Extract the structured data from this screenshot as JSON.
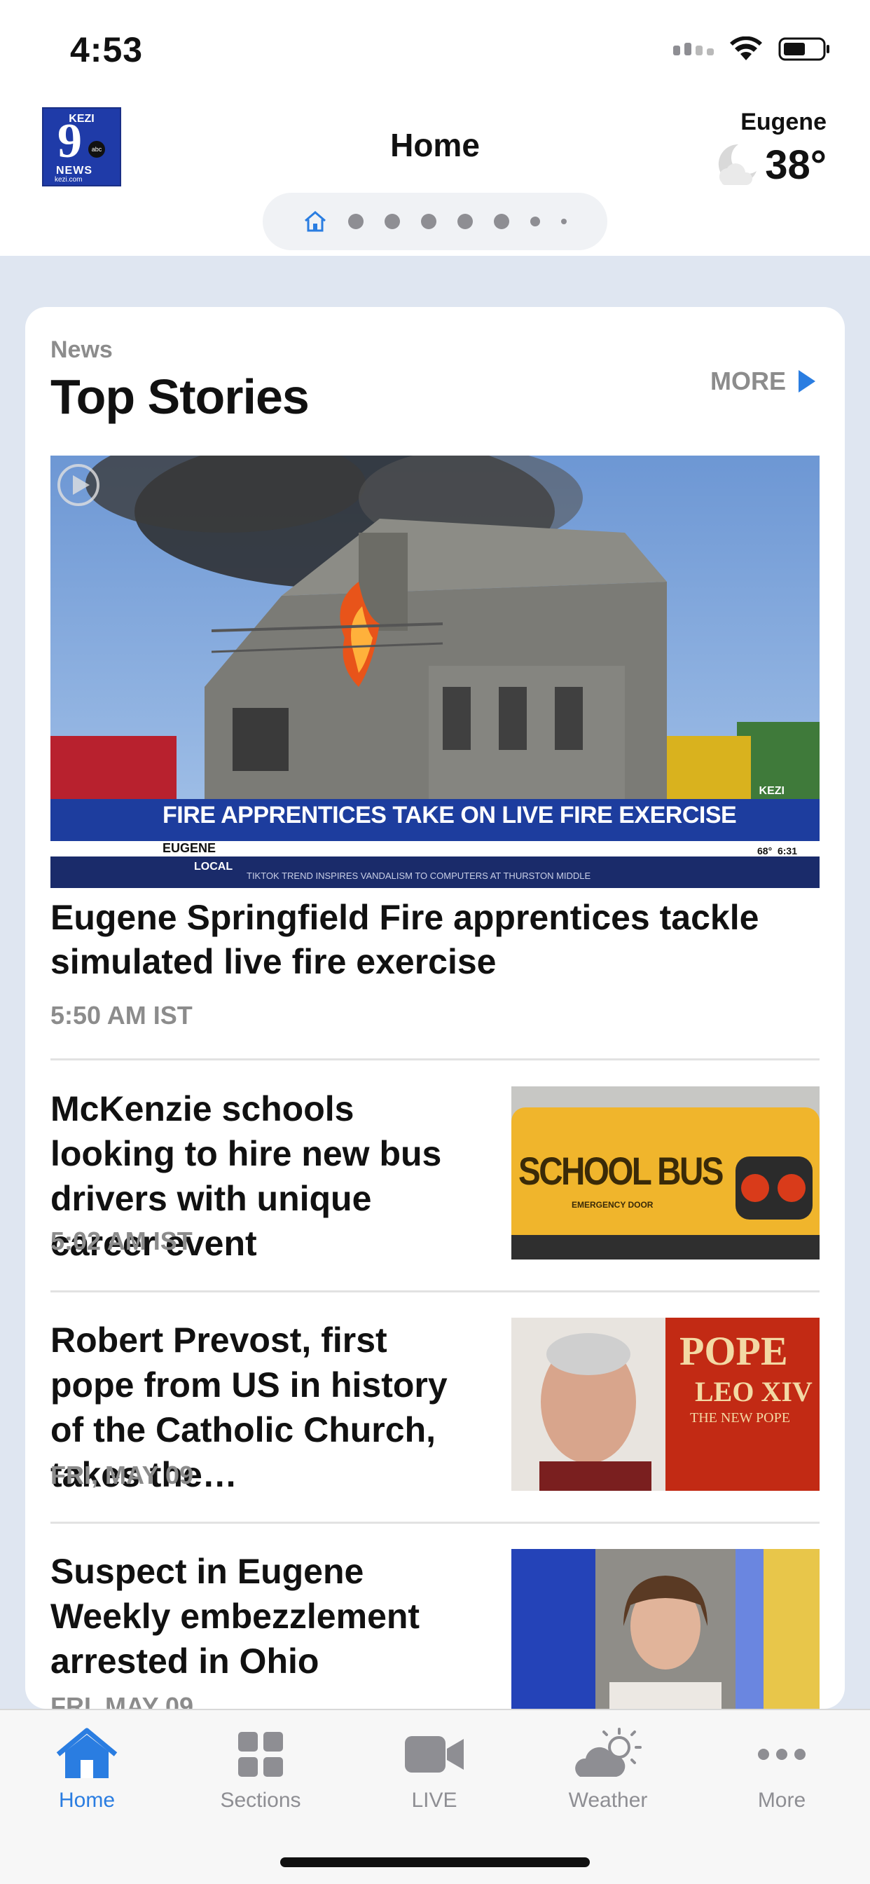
{
  "status_bar": {
    "time": "4:53"
  },
  "header": {
    "logo": {
      "top": "KEZI",
      "nine": "9",
      "news": "NEWS",
      "url": "kezi.com"
    },
    "title": "Home",
    "weather": {
      "city": "Eugene",
      "temp": "38°",
      "icon": "moon-cloud-icon"
    }
  },
  "pager": {
    "active": "home-icon",
    "dots": 7
  },
  "section": {
    "label": "News",
    "title": "Top Stories",
    "more": "MORE"
  },
  "hero": {
    "banner": "FIRE APPRENTICES TAKE ON LIVE FIRE EXERCISE",
    "location": "EUGENE",
    "tag": "LOCAL",
    "ticker": "TIKTOK TREND INSPIRES VANDALISM TO COMPUTERS AT THURSTON MIDDLE",
    "channel": "KEZI",
    "weather_time": "68°  6:31",
    "headline": "Eugene Springfield Fire apprentices tackle simulated live fire exercise",
    "time": "5:50 AM IST"
  },
  "stories": [
    {
      "headline": "McKenzie schools looking to hire new bus drivers with unique career event",
      "time": "5:02 AM IST",
      "thumb_text": "SCHOOL BUS",
      "thumb_sub": "EMERGENCY DOOR"
    },
    {
      "headline": "Robert Prevost, first pope from US in history of the Catholic Church, takes the…",
      "time": "FRI, MAY 09",
      "thumb_text": "POPE",
      "thumb_sub": "LEO XIV",
      "thumb_sub2": "THE NEW POPE"
    },
    {
      "headline": "Suspect in Eugene Weekly embezzlement arrested in Ohio",
      "time": "FRI, MAY 09"
    }
  ],
  "tabbar": {
    "tabs": [
      {
        "label": "Home",
        "icon": "house-icon"
      },
      {
        "label": "Sections",
        "icon": "grid-icon"
      },
      {
        "label": "LIVE",
        "icon": "video-camera-icon"
      },
      {
        "label": "Weather",
        "icon": "cloud-sun-icon"
      },
      {
        "label": "More",
        "icon": "ellipsis-icon"
      }
    ]
  },
  "colors": {
    "accent": "#2a7de1",
    "muted": "#8c8c8c",
    "page_bg": "#dfe6f1"
  }
}
